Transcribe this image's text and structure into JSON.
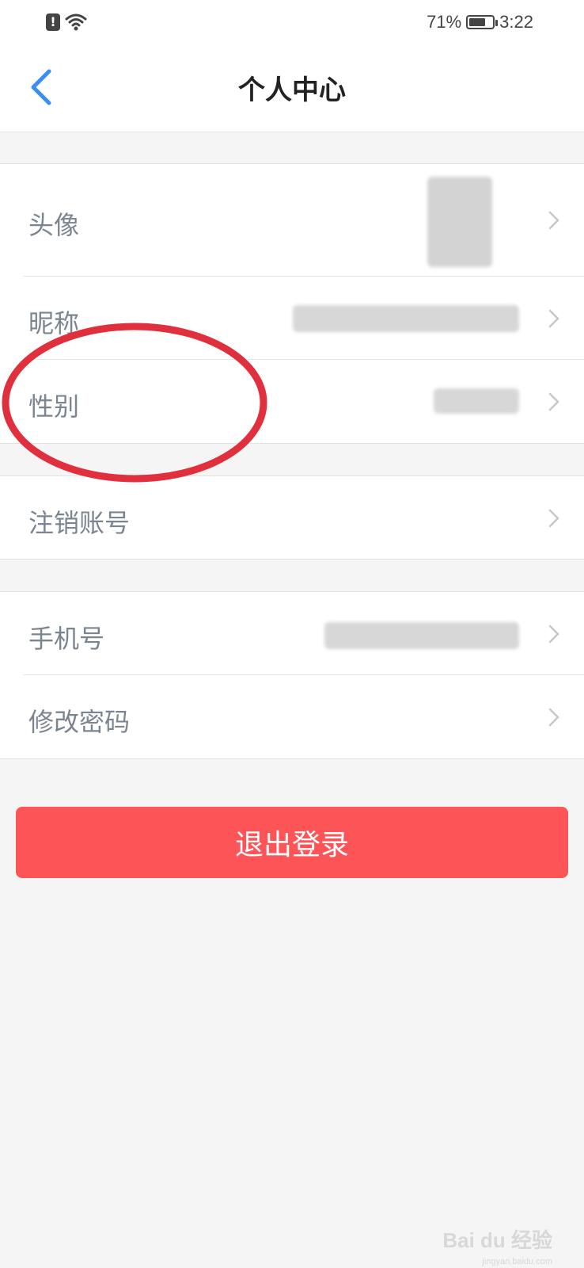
{
  "status_bar": {
    "alert_glyph": "!",
    "battery": "71%",
    "battery_level": 0.71,
    "time": "3:22"
  },
  "header": {
    "title": "个人中心"
  },
  "profile": {
    "avatar_label": "头像",
    "nickname_label": "昵称",
    "gender_label": "性别"
  },
  "account": {
    "cancel_label": "注销账号"
  },
  "security": {
    "phone_label": "手机号",
    "change_password_label": "修改密码"
  },
  "logout_label": "退出登录",
  "watermark": {
    "brand": "Bai du 经验",
    "url": "jingyan.baidu.com"
  },
  "colors": {
    "accent": "#3a8ef6",
    "logout": "#fd5458",
    "annotation": "#e0303e"
  }
}
